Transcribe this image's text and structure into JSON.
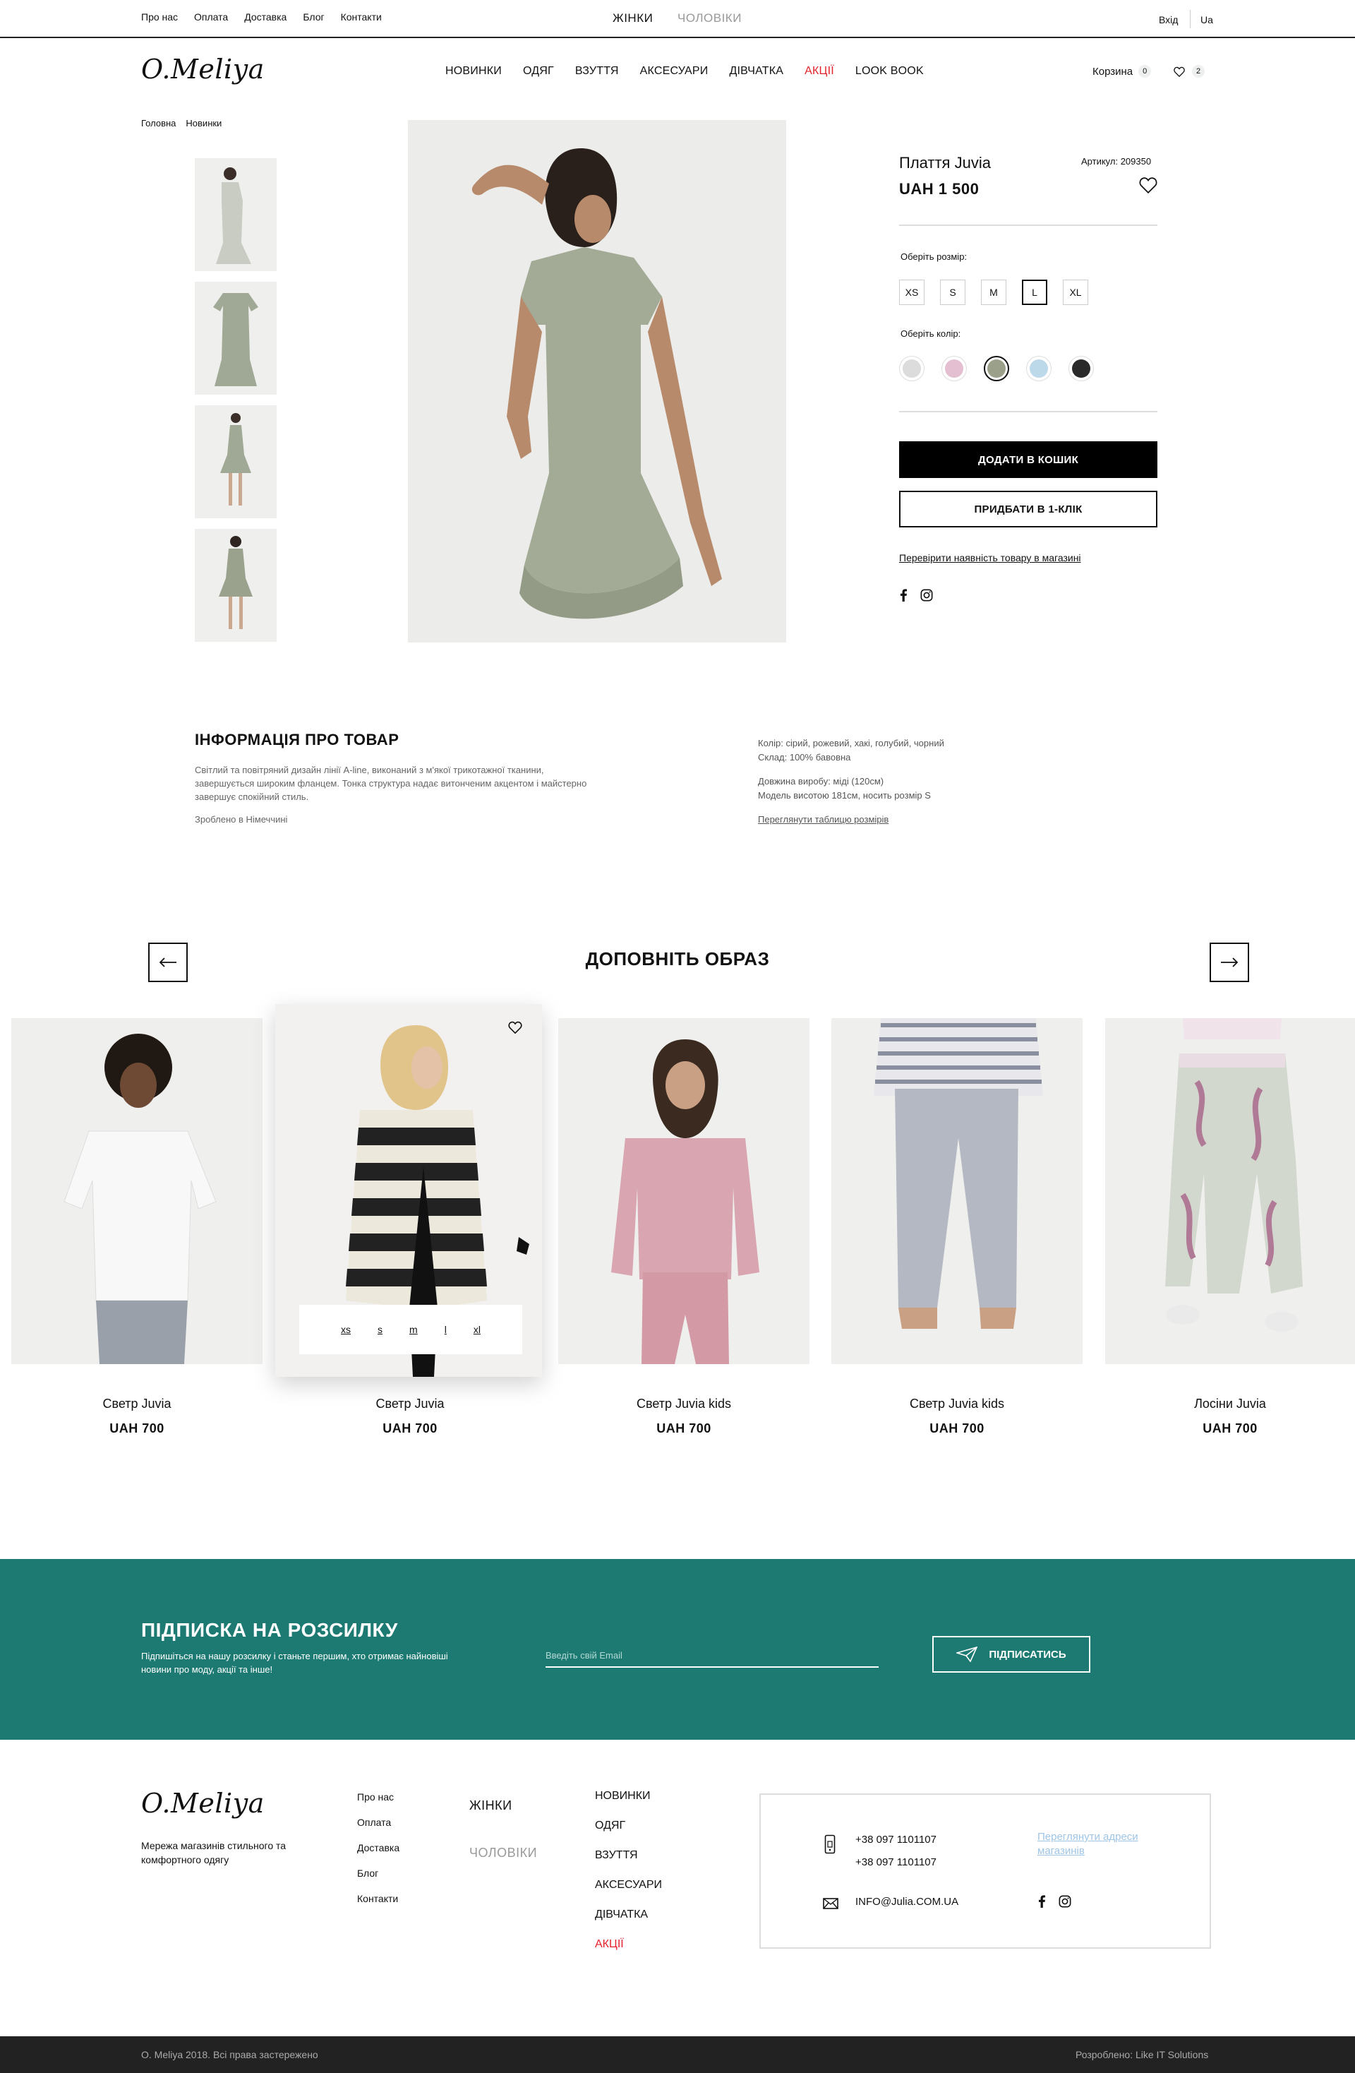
{
  "top_links": [
    "Про нас",
    "Оплата",
    "Доставка",
    "Блог",
    "Контакти"
  ],
  "gender": {
    "women": "ЖІНКИ",
    "men": "ЧОЛОВІКИ"
  },
  "login": "Вхід",
  "lang": "Ua",
  "logo": "O.Meliya",
  "main_nav": [
    "НОВИНКИ",
    "ОДЯГ",
    "ВЗУТТЯ",
    "АКСЕСУАРИ",
    "ДІВЧАТКА",
    "АКЦІЇ",
    "LOOK BOOK"
  ],
  "cart": {
    "label": "Корзина",
    "count": "0",
    "wish_count": "2"
  },
  "breadcrumb": [
    "Головна",
    "Новинки"
  ],
  "product": {
    "title": "Плаття Juvia",
    "price": "UAH  1 500",
    "code": "Артикул: 209350",
    "size_label": "Оберіть розмір:",
    "sizes": [
      "XS",
      "S",
      "M",
      "L",
      "XL"
    ],
    "selected_size": "L",
    "color_label": "Оберіть колір:",
    "colors": [
      "#dcdcdc",
      "#e4bfd2",
      "#9aa08a",
      "#bcd9ea",
      "#2a2a2a"
    ],
    "selected_color_index": 2,
    "add_to_cart": "ДОДАТИ В КОШИК",
    "one_click": "ПРИДБАТИ В 1-КЛІК",
    "check_store": "Перевірити наявність товару в магазині"
  },
  "info": {
    "title": "ІНФОРМАЦІЯ ПРО ТОВАР",
    "text": "Світлий та повітряний дизайн лінії A-line, виконаний з м'якої трикотажної тканини, завершується широким фланцем. Тонка структура надає витонченим акцентом і майстерно завершує спокійний стиль.",
    "made_in": "Зроблено в Німеччині",
    "color_line": "Колір: сірий, рожевий, хакі, голубий, чорний",
    "composition": "Склад: 100% бавовна",
    "length": "Довжина виробу: міді (120см)",
    "model": "Модель висотою 181см, носить розмір S",
    "size_table": "Переглянути таблицю розмірів"
  },
  "look": {
    "title": "ДОПОВНІТЬ ОБРАЗ",
    "hover_sizes": [
      "xs",
      "s",
      "m",
      "l",
      "xl"
    ],
    "items": [
      {
        "name": "Светр Juvia",
        "price": "UAH  700"
      },
      {
        "name": "Светр Juvia",
        "price": "UAH  700"
      },
      {
        "name": "Светр Juvia kids",
        "price": "UAH  700"
      },
      {
        "name": "Светр Juvia kids",
        "price": "UAH  700"
      },
      {
        "name": "Лосіни Juvia",
        "price": "UAH  700"
      }
    ]
  },
  "newsletter": {
    "title": "ПІДПИСКА НА РОЗСИЛКУ",
    "text": "Підпишіться на нашу розсилку і станьте першим, хто отримає найновіші новини про моду, акції та інше!",
    "placeholder": "Введіть свій Email",
    "button": "ПІДПИСАТИСЬ"
  },
  "footer": {
    "logo": "O.Meliya",
    "tagline": "Мережа магазинів стильного та комфортного одягу",
    "links": [
      "Про нас",
      "Оплата",
      "Доставка",
      "Блог",
      "Контакти"
    ],
    "women": "ЖІНКИ",
    "men": "ЧОЛОВІКИ",
    "categories": [
      "НОВИНКИ",
      "ОДЯГ",
      "ВЗУТТЯ",
      "АКСЕСУАРИ",
      "ДІВЧАТКА",
      "АКЦІЇ"
    ],
    "phone1": "+38 097 1101107",
    "phone2": "+38 097 1101107",
    "email": "INFO@Julia.COM.UA",
    "addresses_link": "Переглянути адреси магазинів",
    "copyright": "O. Meliya 2018. Всі права застережено",
    "developer": "Розроблено:  Like IT Solutions"
  }
}
